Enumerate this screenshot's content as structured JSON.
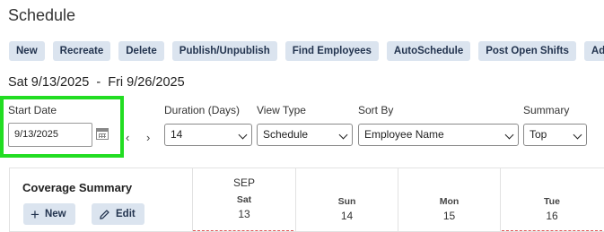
{
  "title": "Schedule",
  "toolbar": {
    "buttons": [
      "New",
      "Recreate",
      "Delete",
      "Publish/Unpublish",
      "Find Employees",
      "AutoSchedule",
      "Post Open Shifts",
      "Add"
    ]
  },
  "date_range": "Sat 9/13/2025  -  Fri 9/26/2025",
  "filters": {
    "start_date": {
      "label": "Start Date",
      "value": "9/13/2025"
    },
    "nav": {
      "prev": "‹",
      "next": "›"
    },
    "duration": {
      "label": "Duration (Days)",
      "value": "14"
    },
    "view_type": {
      "label": "View Type",
      "value": "Schedule"
    },
    "sort_by": {
      "label": "Sort By",
      "value": "Employee Name"
    },
    "summary": {
      "label": "Summary",
      "value": "Top"
    }
  },
  "coverage": {
    "title": "Coverage Summary",
    "new_label": "New",
    "edit_label": "Edit",
    "month": "SEP",
    "days": [
      {
        "dow": "Sat",
        "num": "13"
      },
      {
        "dow": "Sun",
        "num": "14"
      },
      {
        "dow": "Mon",
        "num": "15"
      },
      {
        "dow": "Tue",
        "num": "16"
      }
    ]
  },
  "colors": {
    "highlight": "#22dd22",
    "button_bg": "#dbe4ef",
    "button_text": "#23344f",
    "dash": "#e05555"
  },
  "icons": [
    "calendar-icon",
    "plus-icon",
    "pencil-icon",
    "chevron-down-icon"
  ]
}
